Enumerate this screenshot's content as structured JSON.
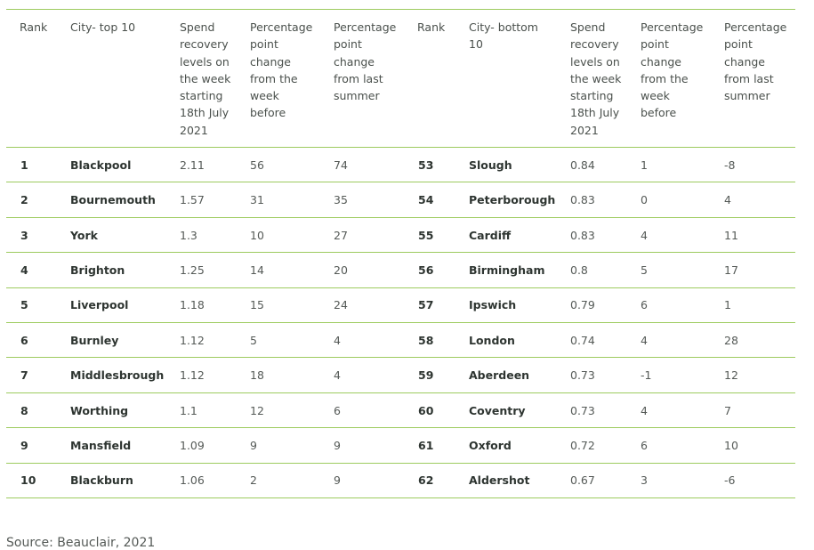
{
  "headers": {
    "rank_top": "Rank",
    "city_top": "City- top 10",
    "spend_top": "Spend recovery levels on the week starting 18th July 2021",
    "change_week_top": "Percentage point change from the week before",
    "change_summer_top": "Percentage point change from last summer",
    "rank_bottom": "Rank",
    "city_bottom": "City- bottom 10",
    "spend_bottom": "Spend recovery levels on the week starting 18th July 2021",
    "change_week_bottom": "Percentage point change from the week before",
    "change_summer_bottom": "Percentage point change from last summer"
  },
  "rows": [
    {
      "top": {
        "rank": "1",
        "city": "Blackpool",
        "spend": "2.11",
        "week": "56",
        "summer": "74"
      },
      "bottom": {
        "rank": "53",
        "city": "Slough",
        "spend": "0.84",
        "week": "1",
        "summer": "-8"
      }
    },
    {
      "top": {
        "rank": "2",
        "city": "Bournemouth",
        "spend": "1.57",
        "week": "31",
        "summer": "35"
      },
      "bottom": {
        "rank": "54",
        "city": "Peterborough",
        "spend": "0.83",
        "week": "0",
        "summer": "4"
      }
    },
    {
      "top": {
        "rank": "3",
        "city": "York",
        "spend": "1.3",
        "week": "10",
        "summer": "27"
      },
      "bottom": {
        "rank": "55",
        "city": "Cardiff",
        "spend": "0.83",
        "week": "4",
        "summer": "11"
      }
    },
    {
      "top": {
        "rank": "4",
        "city": "Brighton",
        "spend": "1.25",
        "week": "14",
        "summer": "20"
      },
      "bottom": {
        "rank": "56",
        "city": "Birmingham",
        "spend": "0.8",
        "week": "5",
        "summer": "17"
      }
    },
    {
      "top": {
        "rank": "5",
        "city": "Liverpool",
        "spend": "1.18",
        "week": "15",
        "summer": "24"
      },
      "bottom": {
        "rank": "57",
        "city": "Ipswich",
        "spend": "0.79",
        "week": "6",
        "summer": "1"
      }
    },
    {
      "top": {
        "rank": "6",
        "city": "Burnley",
        "spend": "1.12",
        "week": "5",
        "summer": "4"
      },
      "bottom": {
        "rank": "58",
        "city": "London",
        "spend": "0.74",
        "week": "4",
        "summer": "28"
      }
    },
    {
      "top": {
        "rank": "7",
        "city": "Middlesbrough",
        "spend": "1.12",
        "week": "18",
        "summer": "4"
      },
      "bottom": {
        "rank": "59",
        "city": "Aberdeen",
        "spend": "0.73",
        "week": "-1",
        "summer": "12"
      }
    },
    {
      "top": {
        "rank": "8",
        "city": "Worthing",
        "spend": "1.1",
        "week": "12",
        "summer": "6"
      },
      "bottom": {
        "rank": "60",
        "city": "Coventry",
        "spend": "0.73",
        "week": "4",
        "summer": "7"
      }
    },
    {
      "top": {
        "rank": "9",
        "city": "Mansfield",
        "spend": "1.09",
        "week": "9",
        "summer": "9"
      },
      "bottom": {
        "rank": "61",
        "city": "Oxford",
        "spend": "0.72",
        "week": "6",
        "summer": "10"
      }
    },
    {
      "top": {
        "rank": "10",
        "city": "Blackburn",
        "spend": "1.06",
        "week": "2",
        "summer": "9"
      },
      "bottom": {
        "rank": "62",
        "city": "Aldershot",
        "spend": "0.67",
        "week": "3",
        "summer": "-6"
      }
    }
  ],
  "source": "Source: Beauclair, 2021",
  "colors": {
    "rule": "#9dcb5f",
    "text": "#555a57",
    "bold_text": "#2e3531"
  }
}
